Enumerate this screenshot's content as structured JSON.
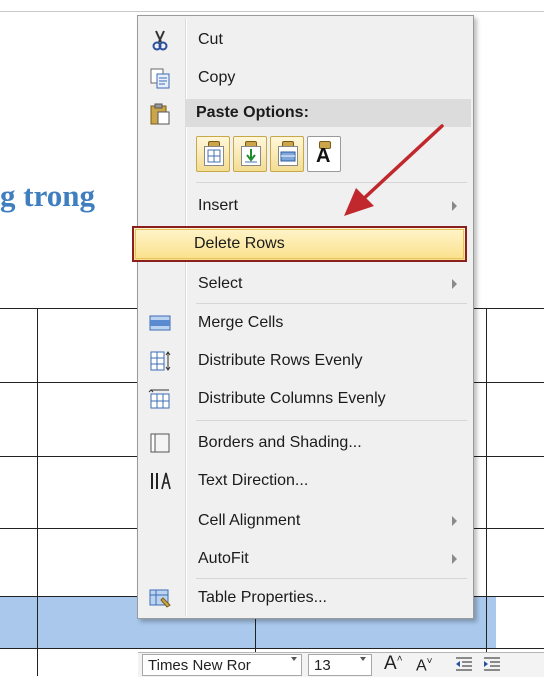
{
  "document": {
    "heading_fragment": "g trong"
  },
  "context_menu": {
    "items": [
      {
        "label": "Cut",
        "icon": "scissors-icon"
      },
      {
        "label": "Copy",
        "icon": "copy-icon"
      },
      {
        "label": "Paste Options:",
        "icon": "paste-icon"
      },
      {
        "label": "Insert",
        "submenu": true
      },
      {
        "label": "Delete Rows",
        "highlighted": true
      },
      {
        "label": "Select",
        "submenu": true
      },
      {
        "label": "Merge Cells",
        "icon": "merge-cells-icon"
      },
      {
        "label": "Distribute Rows Evenly",
        "icon": "distribute-rows-icon"
      },
      {
        "label": "Distribute Columns Evenly",
        "icon": "distribute-columns-icon"
      },
      {
        "label": "Borders and Shading...",
        "icon": "borders-icon"
      },
      {
        "label": "Text Direction...",
        "icon": "text-direction-icon"
      },
      {
        "label": "Cell Alignment",
        "submenu": true
      },
      {
        "label": "AutoFit",
        "submenu": true
      },
      {
        "label": "Table Properties...",
        "icon": "table-properties-icon"
      }
    ],
    "paste_options": [
      {
        "icon": "paste-nest-table-icon"
      },
      {
        "icon": "paste-merge-table-icon"
      },
      {
        "icon": "paste-insert-rows-icon"
      },
      {
        "icon": "paste-keep-text-only-icon",
        "glyph": "A"
      }
    ]
  },
  "annotation": {
    "color": "#c0282d"
  },
  "mini_toolbar": {
    "font_name": "Times New Ror",
    "font_size": "13",
    "grow_font": "A",
    "shrink_font": "A"
  },
  "colors": {
    "highlight_border": "#8b1e1e",
    "highlight_fill": "#fbe08a",
    "heading": "#3f7fbf",
    "selected_row": "#a9c8ec"
  }
}
